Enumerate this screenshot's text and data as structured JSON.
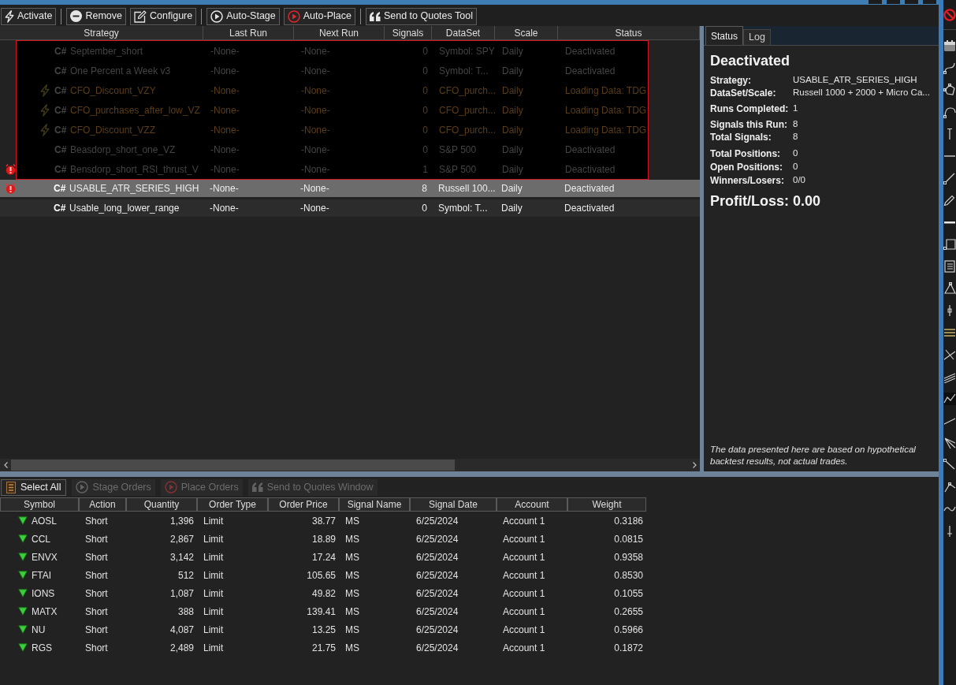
{
  "toolbar_groups": [
    [
      "Activate"
    ],
    [
      "Remove",
      "Configure"
    ],
    [
      "Auto-Stage",
      "Auto-Place"
    ],
    [
      "Send to Quotes Tool"
    ]
  ],
  "strategy_table": {
    "columns": [
      "Strategy",
      "Last Run",
      "Next Run",
      "Signals",
      "DataSet",
      "Scale",
      "Status"
    ],
    "covered_rows": [
      {
        "alert": false,
        "auto": false,
        "language": "C#",
        "name": "September_short",
        "last_run": "-None-",
        "next_run": "-None-",
        "signals": "0",
        "dataset": "Symbol: SPY",
        "scale": "Daily",
        "status": "Deactivated",
        "kind": "idle",
        "selected": false
      },
      {
        "alert": false,
        "auto": false,
        "language": "C#",
        "name": "One Percent a Week v3",
        "last_run": "-None-",
        "next_run": "-None-",
        "signals": "0",
        "dataset": "Symbol: T...",
        "scale": "Daily",
        "status": "Deactivated",
        "kind": "idle",
        "selected": false
      },
      {
        "alert": false,
        "auto": true,
        "language": "C#",
        "name": "CFO_Discount_VZY",
        "last_run": "-None-",
        "next_run": "-None-",
        "signals": "0",
        "dataset": "CFO_purch...",
        "scale": "Daily",
        "status": "Loading Data: TDG",
        "kind": "loading",
        "selected": false
      },
      {
        "alert": false,
        "auto": true,
        "language": "C#",
        "name": "CFO_purchases_after_low_VZ",
        "last_run": "-None-",
        "next_run": "-None-",
        "signals": "0",
        "dataset": "CFO_purch...",
        "scale": "Daily",
        "status": "Loading Data: TDG",
        "kind": "loading",
        "selected": false
      },
      {
        "alert": false,
        "auto": true,
        "language": "C#",
        "name": "CFO_Discount_VZZ",
        "last_run": "-None-",
        "next_run": "-None-",
        "signals": "0",
        "dataset": "CFO_purch...",
        "scale": "Daily",
        "status": "Loading Data: TDG",
        "kind": "loading",
        "selected": false
      },
      {
        "alert": false,
        "auto": false,
        "language": "C#",
        "name": "Beasdorp_short_one_VZ",
        "last_run": "-None-",
        "next_run": "-None-",
        "signals": "0",
        "dataset": "S&P 500",
        "scale": "Daily",
        "status": "Deactivated",
        "kind": "idle",
        "selected": false
      },
      {
        "alert": true,
        "auto": false,
        "language": "C#",
        "name": "Bensdorp_short_RSI_thrust_V",
        "last_run": "-None-",
        "next_run": "-None-",
        "signals": "1",
        "dataset": "S&P 500",
        "scale": "Daily",
        "status": "Deactivated",
        "kind": "idle",
        "selected": false
      }
    ],
    "rows": [
      {
        "alert": true,
        "auto": false,
        "language": "C#",
        "name": "USABLE_ATR_SERIES_HIGH",
        "last_run": "-None-",
        "next_run": "-None-",
        "signals": "8",
        "dataset": "Russell 100...",
        "scale": "Daily",
        "status": "Deactivated",
        "kind": "idle",
        "selected": true
      },
      {
        "alert": false,
        "auto": false,
        "language": "C#",
        "name": "Usable_long_lower_range",
        "last_run": "-None-",
        "next_run": "-None-",
        "signals": "0",
        "dataset": "Symbol: T...",
        "scale": "Daily",
        "status": "Deactivated",
        "kind": "idle",
        "selected": false
      }
    ]
  },
  "details_panel": {
    "tabs": [
      {
        "label": "Status",
        "selected": true
      },
      {
        "label": "Log",
        "selected": false
      }
    ],
    "heading": "Deactivated",
    "field_groups": [
      [
        {
          "label": "Strategy:",
          "value": "USABLE_ATR_SERIES_HIGH"
        },
        {
          "label": "DataSet/Scale:",
          "value": "Russell 1000 + 2000 + Micro Ca..."
        }
      ],
      [
        {
          "label": "Runs Completed:",
          "value": "1"
        }
      ],
      [
        {
          "label": "Signals this Run:",
          "value": "8"
        },
        {
          "label": "Total Signals:",
          "value": "8"
        }
      ],
      [
        {
          "label": "Total Positions:",
          "value": "0"
        },
        {
          "label": "Open Positions:",
          "value": "0"
        },
        {
          "label": "Winners/Losers:",
          "value": "0/0"
        }
      ]
    ],
    "profit_loss": {
      "label": "Profit/Loss:",
      "value": "0.00"
    },
    "disclaimer": "The data presented here are based on hypothetical backtest results, not actual trades."
  },
  "order_toolbar": [
    {
      "label": "Select All",
      "disabled": false
    },
    {
      "label": "Stage Orders",
      "disabled": true
    },
    {
      "label": "Place Orders",
      "disabled": true
    },
    {
      "label": "Send to Quotes Window",
      "disabled": true
    }
  ],
  "orders": {
    "columns": [
      "Symbol",
      "Action",
      "Quantity",
      "Order Type",
      "Order Price",
      "Signal Name",
      "Signal Date",
      "Account",
      "Weight"
    ],
    "rows": [
      {
        "symbol": "AOSL",
        "action": "Short",
        "quantity": "1,396",
        "order_type": "Limit",
        "order_price": "38.77",
        "signal_name": "MS",
        "signal_date": "6/25/2024",
        "account": "Account 1",
        "weight": "0.3186"
      },
      {
        "symbol": "CCL",
        "action": "Short",
        "quantity": "2,867",
        "order_type": "Limit",
        "order_price": "18.89",
        "signal_name": "MS",
        "signal_date": "6/25/2024",
        "account": "Account 1",
        "weight": "0.0815"
      },
      {
        "symbol": "ENVX",
        "action": "Short",
        "quantity": "3,142",
        "order_type": "Limit",
        "order_price": "17.24",
        "signal_name": "MS",
        "signal_date": "6/25/2024",
        "account": "Account 1",
        "weight": "0.9358"
      },
      {
        "symbol": "FTAI",
        "action": "Short",
        "quantity": "512",
        "order_type": "Limit",
        "order_price": "105.65",
        "signal_name": "MS",
        "signal_date": "6/25/2024",
        "account": "Account 1",
        "weight": "0.8530"
      },
      {
        "symbol": "IONS",
        "action": "Short",
        "quantity": "1,087",
        "order_type": "Limit",
        "order_price": "49.82",
        "signal_name": "MS",
        "signal_date": "6/25/2024",
        "account": "Account 1",
        "weight": "0.1055"
      },
      {
        "symbol": "MATX",
        "action": "Short",
        "quantity": "388",
        "order_type": "Limit",
        "order_price": "139.41",
        "signal_name": "MS",
        "signal_date": "6/25/2024",
        "account": "Account 1",
        "weight": "0.2655"
      },
      {
        "symbol": "NU",
        "action": "Short",
        "quantity": "4,087",
        "order_type": "Limit",
        "order_price": "13.25",
        "signal_name": "MS",
        "signal_date": "6/25/2024",
        "account": "Account 1",
        "weight": "0.5966"
      },
      {
        "symbol": "RGS",
        "action": "Short",
        "quantity": "2,489",
        "order_type": "Limit",
        "order_price": "21.75",
        "signal_name": "MS",
        "signal_date": "6/25/2024",
        "account": "Account 1",
        "weight": "0.1872"
      }
    ]
  }
}
